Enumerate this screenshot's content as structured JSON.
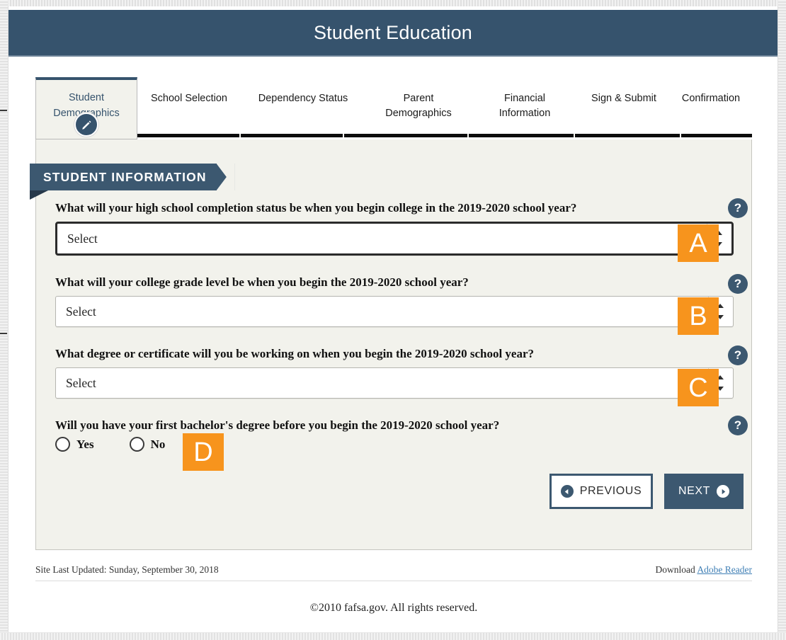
{
  "header": {
    "title": "Student Education"
  },
  "tabs": [
    {
      "id": "student-demographics",
      "label_line1": "Student",
      "label_line2": "Demographics",
      "active": true,
      "icon": "pencil-icon"
    },
    {
      "id": "school-selection",
      "label_line1": "School Selection",
      "label_line2": "",
      "active": false
    },
    {
      "id": "dependency-status",
      "label_line1": "Dependency Status",
      "label_line2": "",
      "active": false
    },
    {
      "id": "parent-demographics",
      "label_line1": "Parent",
      "label_line2": "Demographics",
      "active": false
    },
    {
      "id": "financial-information",
      "label_line1": "Financial",
      "label_line2": "Information",
      "active": false
    },
    {
      "id": "sign-submit",
      "label_line1": "Sign & Submit",
      "label_line2": "",
      "active": false
    },
    {
      "id": "confirmation",
      "label_line1": "Confirmation",
      "label_line2": "",
      "active": false
    }
  ],
  "section": {
    "banner": "STUDENT INFORMATION"
  },
  "questions": [
    {
      "id": "high-school-completion-status",
      "label": "What will your high school completion status be when you begin college in the 2019-2020 school year?",
      "control": "select",
      "value": "Select",
      "focused": true,
      "help": "?",
      "callout": "A"
    },
    {
      "id": "college-grade-level",
      "label": "What will your college grade level be when you begin the 2019-2020 school year?",
      "control": "select",
      "value": "Select",
      "focused": false,
      "help": "?",
      "callout": "B"
    },
    {
      "id": "degree-or-certificate",
      "label": "What degree or certificate will you be working on when you begin the 2019-2020 school year?",
      "control": "select",
      "value": "Select",
      "focused": false,
      "help": "?",
      "callout": "C"
    },
    {
      "id": "first-bachelors-degree",
      "label": "Will you have your first bachelor's degree before you begin the 2019-2020 school year?",
      "control": "radio",
      "options": [
        "Yes",
        "No"
      ],
      "selected": "",
      "help": "?",
      "callout": "D"
    }
  ],
  "buttons": {
    "previous": "PREVIOUS",
    "next": "NEXT"
  },
  "footer": {
    "last_updated": "Site Last Updated: Sunday, September 30, 2018",
    "download_prefix": "Download ",
    "download_link": "Adobe Reader",
    "copyright": "©2010 fafsa.gov. All rights reserved."
  },
  "colors": {
    "header_navy": "#36536d",
    "ribbon_navy": "#3c5870",
    "panel_bg": "#f2f2ec",
    "callout_orange": "#f7941d",
    "link_blue": "#3f7fb5"
  }
}
